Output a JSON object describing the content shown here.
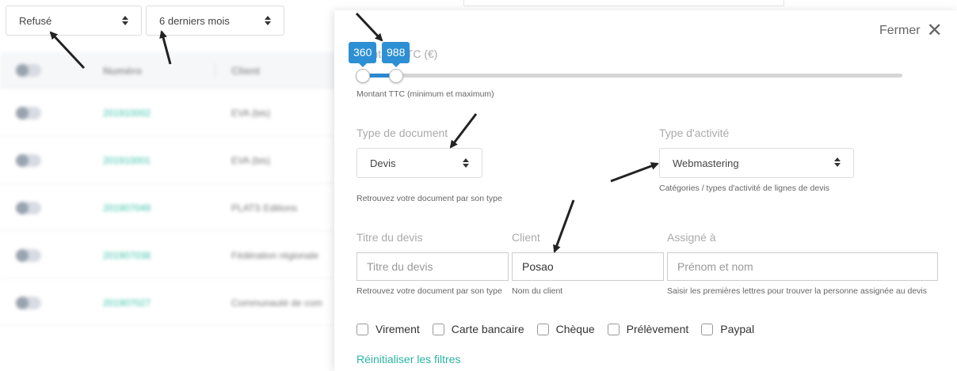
{
  "filters": {
    "status_value": "Refusé",
    "period_value": "6 derniers mois"
  },
  "table": {
    "headers": [
      "Numéro",
      "Client"
    ],
    "rows": [
      {
        "numero": "201910002",
        "client": "EVA (bis)"
      },
      {
        "numero": "201910001",
        "client": "EVA (bis)"
      },
      {
        "numero": "201907049",
        "client": "PLATS Editions"
      },
      {
        "numero": "201907038",
        "client": "Fédération régionale"
      },
      {
        "numero": "201907027",
        "client": "Communauté de com"
      }
    ]
  },
  "panel": {
    "close_label": "Fermer",
    "range": {
      "label": "Montant TTC (€)",
      "min": 360,
      "max": 988,
      "min_label": "360",
      "max_label": "988",
      "help": "Montant TTC (minimum et maximum)"
    },
    "doc_type": {
      "label": "Type de document",
      "value": "Devis",
      "help": "Retrouvez votre document par son type"
    },
    "activity": {
      "label": "Type d'activité",
      "value": "Webmastering",
      "help": "Catégories / types d'activité de lignes de devis"
    },
    "title_field": {
      "label": "Titre du devis",
      "placeholder": "Titre du devis",
      "help": "Retrouvez votre document par son type"
    },
    "client_field": {
      "label": "Client",
      "value": "Posao",
      "help": "Nom du client"
    },
    "assigned_field": {
      "label": "Assigné à",
      "placeholder": "Prénom et nom",
      "help": "Saisir les premières lettres pour trouver la personne assignée au devis"
    },
    "payments": [
      "Virement",
      "Carte bancaire",
      "Chèque",
      "Prélèvement",
      "Paypal"
    ],
    "reset_label": "Réinitialiser les filtres"
  },
  "colors": {
    "accent_blue": "#2d8fd4",
    "link_teal": "#2bb5a0"
  }
}
